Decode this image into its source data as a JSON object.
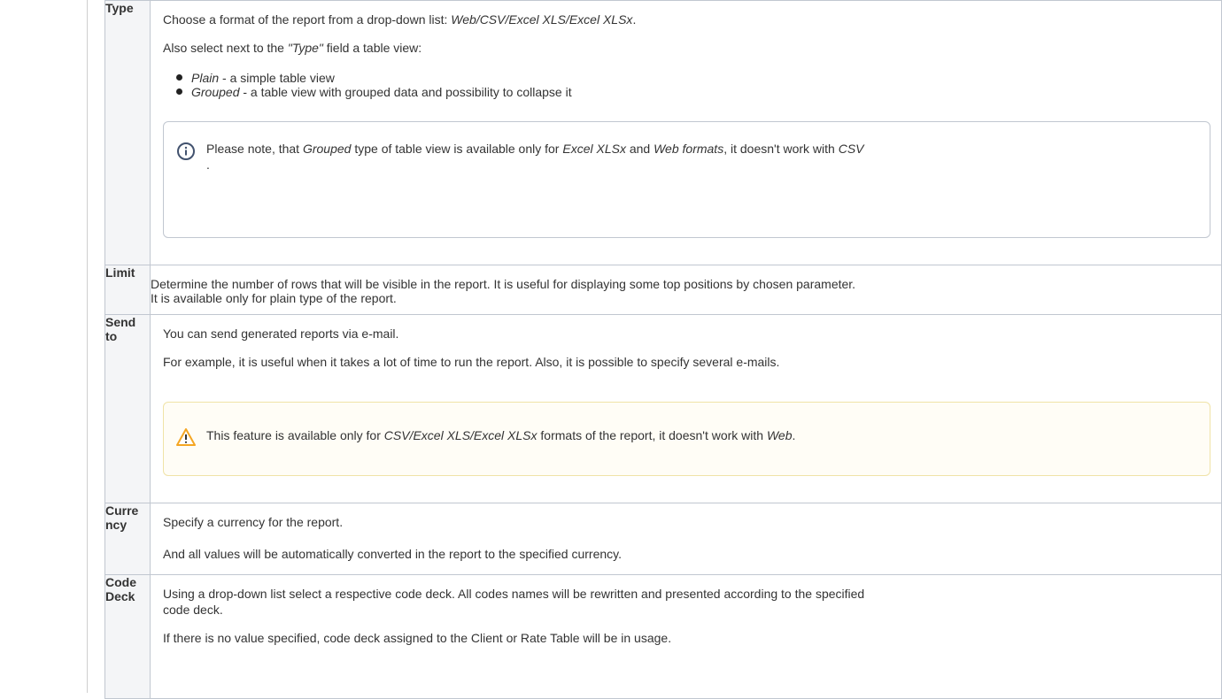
{
  "rows": {
    "type": {
      "label": "Type",
      "p1_pre": "Choose a format of the report from a drop-down list: ",
      "p1_em": "Web/CSV/Excel XLS/Excel XLSx",
      "p1_post": ".",
      "p2_pre": "Also select next to the ",
      "p2_em": "\"Type\"",
      "p2_post": " field a table view:",
      "bullets": [
        {
          "em": "Plain",
          "text": " - a simple table view"
        },
        {
          "em": "Grouped",
          "text": " - a table view with grouped data and possibility to collapse it"
        }
      ],
      "note": {
        "t1": "Please note, that ",
        "em1": "Grouped",
        "t2": " type of table view is available only for ",
        "em2": "Excel XLSx",
        "t3": " and ",
        "em3": "Web formats",
        "t4": ", it doesn't work with ",
        "em4": "CSV",
        "t5": "."
      }
    },
    "limit": {
      "label": "Limit",
      "line1": "Determine the number of rows that will be visible in the report. It is useful for displaying some top positions by chosen parameter.",
      "line2": "It is available only for plain type of the report."
    },
    "send_to": {
      "label_line1": "Send",
      "label_line2": "to",
      "p1": "You can send generated reports via e-mail.",
      "p2": "For example, it is useful when it takes a lot of time to run the report. Also, it is possible to specify several e-mails.",
      "warning": {
        "t1": "This feature is available only for ",
        "em1": "CSV/Excel XLS/Excel XLSx",
        "t2": " formats of the report, it doesn't work with ",
        "em2": "Web",
        "t3": "."
      }
    },
    "currency": {
      "label_line1": "Curre",
      "label_line2": "ncy",
      "p1": "Specify a currency for the report.",
      "p2": "And all values will be automatically converted in the report to the specified currency."
    },
    "code_deck": {
      "label_line1": "Code",
      "label_line2": "Deck",
      "line1": "Using a drop-down list select a respective code deck. All codes names will be rewritten and presented according to the specified",
      "line2": "code deck.",
      "p2": "If there is no value specified, code deck assigned to the Client or Rate Table will be in usage."
    }
  },
  "icons": {
    "info": "info-circle-icon",
    "warning": "warning-triangle-icon"
  },
  "colors": {
    "border": "#c1c7d0",
    "label_bg": "#f4f5f7",
    "info_icon": "#42526e",
    "warning_icon": "#f5a623",
    "warning_bg": "#fffdf6",
    "warning_border": "#f0e3a7"
  }
}
